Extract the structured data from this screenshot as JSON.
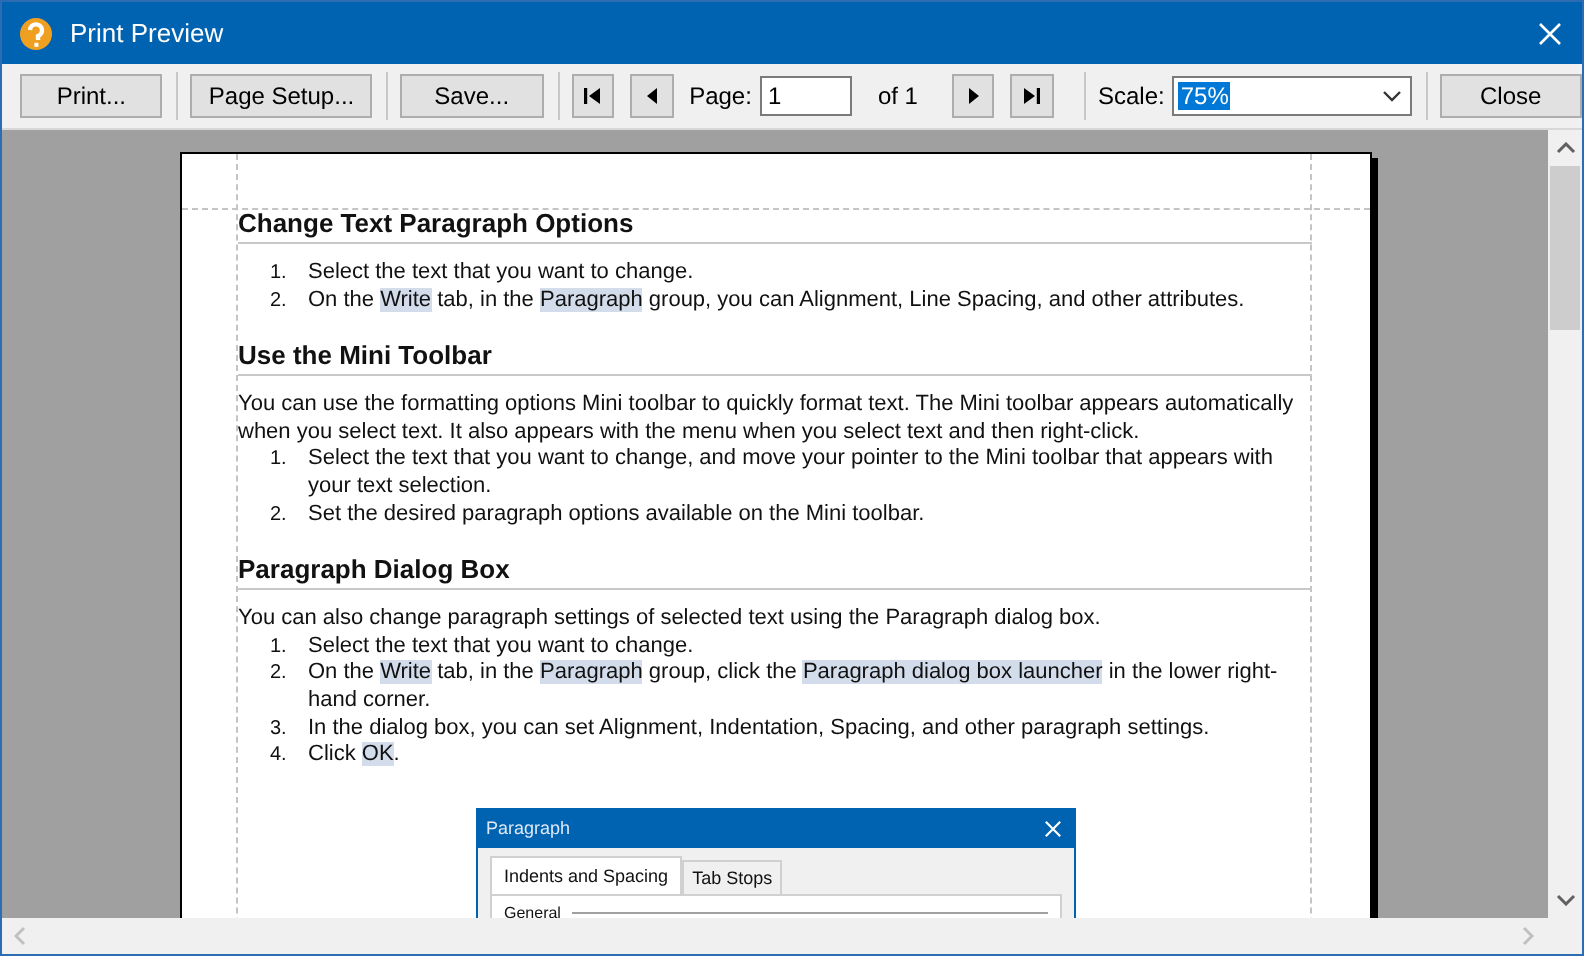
{
  "window": {
    "title": "Print Preview"
  },
  "toolbar": {
    "print": "Print...",
    "page_setup": "Page Setup...",
    "save": "Save...",
    "page_label": "Page:",
    "page_value": "1",
    "page_of": "of 1",
    "scale_label": "Scale:",
    "scale_value": "75%",
    "scale_text_selected": true,
    "close": "Close"
  },
  "document": {
    "sections": [
      {
        "heading": "Change Text  Paragraph Options",
        "blocks": [
          {
            "kind": "list",
            "items": [
              {
                "number": "1.",
                "parts": [
                  {
                    "text": "Select the text that you want to change.",
                    "highlight": false
                  }
                ]
              },
              {
                "number": "2.",
                "parts": [
                  {
                    "text": "On the ",
                    "highlight": false
                  },
                  {
                    "text": "Write",
                    "highlight": true
                  },
                  {
                    "text": " tab, in the ",
                    "highlight": false
                  },
                  {
                    "text": "Paragraph",
                    "highlight": true
                  },
                  {
                    "text": " group, you can Alignment, Line Spacing, and other attributes.",
                    "highlight": false
                  }
                ]
              }
            ]
          }
        ]
      },
      {
        "heading": "Use the Mini Toolbar",
        "blocks": [
          {
            "kind": "paragraph",
            "parts": [
              {
                "text": "You can use the formatting options Mini toolbar to quickly format text. The Mini toolbar appears automatically when you select text. It also appears with the menu  when you select text and then right-click.",
                "highlight": false
              }
            ]
          },
          {
            "kind": "list",
            "items": [
              {
                "number": "1.",
                "parts": [
                  {
                    "text": "Select the text that you want to change, and move  your pointer to the Mini toolbar that appears with your text selection.",
                    "highlight": false
                  }
                ]
              },
              {
                "number": "2.",
                "parts": [
                  {
                    "text": "Set the desired paragraph options available on the Mini toolbar.",
                    "highlight": false
                  }
                ]
              }
            ]
          }
        ]
      },
      {
        "heading": "Paragraph Dialog Box",
        "blocks": [
          {
            "kind": "paragraph",
            "parts": [
              {
                "text": "You can also change paragraph settings of selected text using the Paragraph dialog box.",
                "highlight": false
              }
            ]
          },
          {
            "kind": "list",
            "items": [
              {
                "number": "1.",
                "parts": [
                  {
                    "text": "Select the text that you want to change.",
                    "highlight": false
                  }
                ]
              },
              {
                "number": "2.",
                "parts": [
                  {
                    "text": "On the ",
                    "highlight": false
                  },
                  {
                    "text": "Write",
                    "highlight": true
                  },
                  {
                    "text": " tab, in the ",
                    "highlight": false
                  },
                  {
                    "text": "Paragraph",
                    "highlight": true
                  },
                  {
                    "text": " group, click the ",
                    "highlight": false
                  },
                  {
                    "text": "Paragraph dialog box launcher",
                    "highlight": true
                  },
                  {
                    "text": " in the lower right-hand corner.",
                    "highlight": false
                  }
                ]
              },
              {
                "number": "3.",
                "parts": [
                  {
                    "text": "In the dialog box, you can set Alignment, Indentation, Spacing, and other paragraph settings.",
                    "highlight": false
                  }
                ]
              },
              {
                "number": "4.",
                "parts": [
                  {
                    "text": "Click ",
                    "highlight": false
                  },
                  {
                    "text": "OK",
                    "highlight": true
                  },
                  {
                    "text": ".",
                    "highlight": false
                  }
                ]
              }
            ]
          }
        ]
      }
    ],
    "figure": {
      "title": "Paragraph",
      "tabs": [
        {
          "label": "Indents and Spacing",
          "selected": true
        },
        {
          "label": "Tab Stops",
          "selected": false
        }
      ],
      "group": "General"
    }
  }
}
